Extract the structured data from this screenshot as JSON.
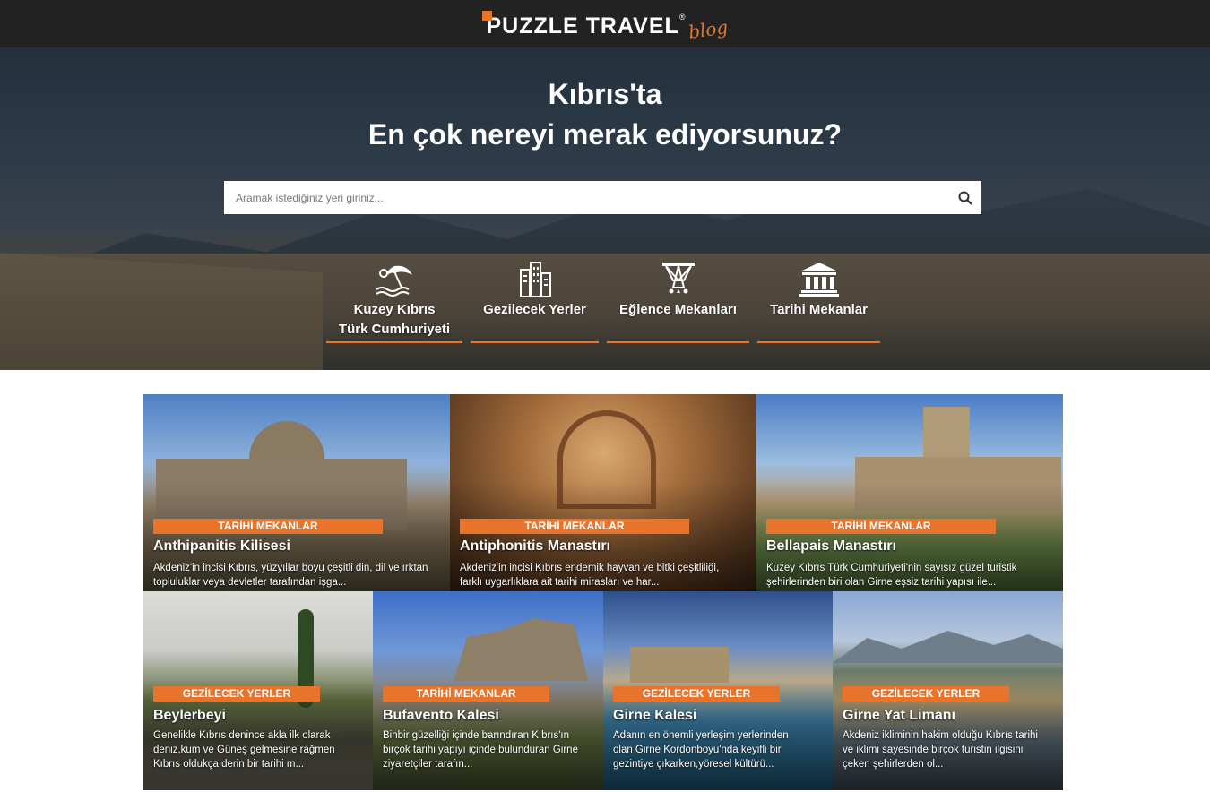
{
  "header": {
    "brand": "PUZZLE TRAVEL",
    "brand_mark": "®",
    "brand_suffix": "blog"
  },
  "hero": {
    "title_line1": "Kıbrıs'ta",
    "title_line2": "En çok nereyi merak ediyorsunuz?",
    "search": {
      "placeholder": "Aramak istediğiniz yeri giriniz...",
      "icon": "search-icon"
    },
    "categories": [
      {
        "label_line1": "Kuzey Kıbrıs",
        "label_line2": "Türk Cumhuriyeti",
        "icon": "beach-umbrella-icon"
      },
      {
        "label_line1": "Gezilecek Yerler",
        "label_line2": "",
        "icon": "city-buildings-icon"
      },
      {
        "label_line1": "Eğlence Mekanları",
        "label_line2": "",
        "icon": "stage-lights-icon"
      },
      {
        "label_line1": "Tarihi Mekanlar",
        "label_line2": "",
        "icon": "museum-icon"
      }
    ]
  },
  "posts": [
    {
      "category": "TARİHİ MEKANLAR",
      "title": "Anthipanitis Kilisesi",
      "excerpt_line1": "Akdeniz'in incisi Kıbrıs, yüzyıllar boyu çeşitli din, dil ve ırktan",
      "excerpt_line2": "topluluklar veya devletler tarafından işga..."
    },
    {
      "category": "TARİHİ MEKANLAR",
      "title": "Antiphonitis Manastırı",
      "excerpt_line1": "Akdeniz'in incisi Kıbrıs endemik hayvan ve bitki çeşitliliği,",
      "excerpt_line2": "farklı uygarlıklara ait tarihi mirasları ve har..."
    },
    {
      "category": "TARİHİ MEKANLAR",
      "title": "Bellapais Manastırı",
      "excerpt_line1": "Kuzey Kıbrıs Türk Cumhuriyeti'nin sayısız güzel turistik",
      "excerpt_line2": "şehirlerinden biri olan Girne eşsiz tarihi yapısı ile..."
    },
    {
      "category": "GEZİLECEK YERLER",
      "title": "Beylerbeyi",
      "excerpt_line1": "Genelikle Kıbrıs denince akla ilk olarak",
      "excerpt_line2": "deniz,kum ve Güneş gelmesine rağmen",
      "excerpt_line3": "Kıbrıs oldukça derin bir tarihi m..."
    },
    {
      "category": "TARİHİ MEKANLAR",
      "title": "Bufavento Kalesi",
      "excerpt_line1": "Binbir güzelliği içinde barındıran Kıbrıs'ın",
      "excerpt_line2": "birçok tarihi yapıyı içinde bulunduran Girne",
      "excerpt_line3": "ziyaretçiler tarafın..."
    },
    {
      "category": "GEZİLECEK YERLER",
      "title": "Girne Kalesi",
      "excerpt_line1": "Adanın en önemli yerleşim yerlerinden",
      "excerpt_line2": "olan Girne Kordonboyu'nda keyifli bir",
      "excerpt_line3": "gezintiye çıkarken,yöresel kültürü..."
    },
    {
      "category": "GEZİLECEK YERLER",
      "title": "Girne Yat Limanı",
      "excerpt_line1": "Akdeniz ikliminin hakim olduğu Kıbrıs tarihi",
      "excerpt_line2": "ve iklimi sayesinde birçok turistin ilgisini",
      "excerpt_line3": "çeken şehirlerden ol..."
    }
  ],
  "colors": {
    "accent": "#e8742c",
    "topbar": "#222222"
  }
}
